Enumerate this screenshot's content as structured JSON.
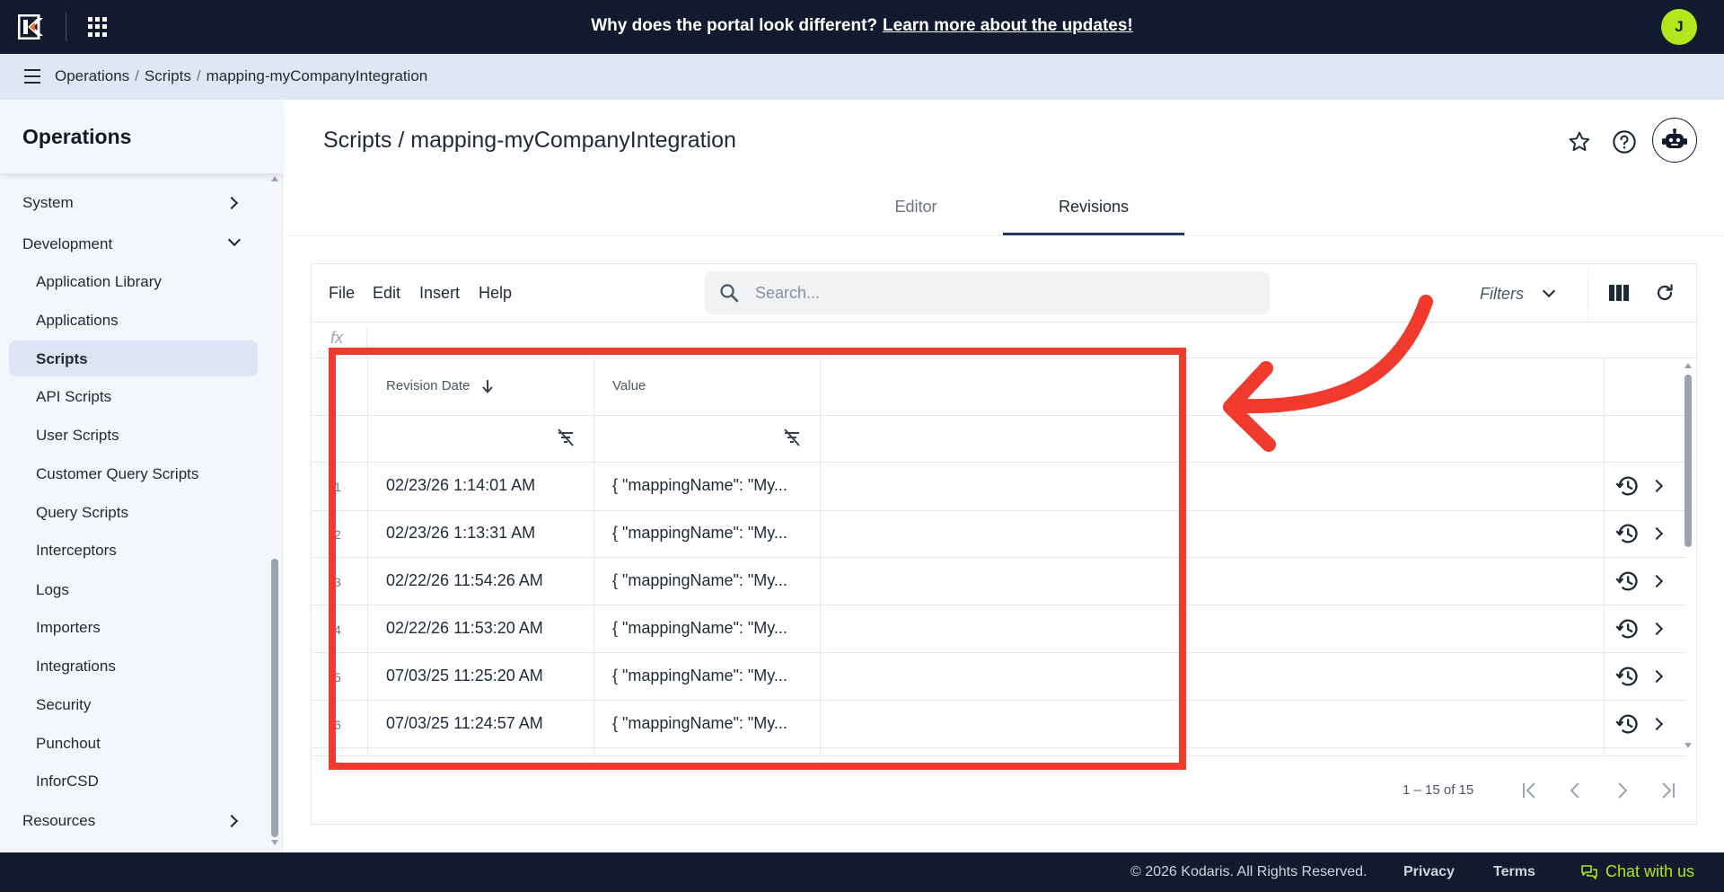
{
  "topbar": {
    "announcement": "Why does the portal look different?",
    "announcement_link": "Learn more about the updates!",
    "avatar_initial": "J",
    "accent": "#b5e61d",
    "background": "#111a2e"
  },
  "breadcrumb": {
    "items": [
      "Operations",
      "Scripts",
      "mapping-myCompanyIntegration"
    ],
    "separator": "/"
  },
  "sidebar": {
    "title": "Operations",
    "items": [
      {
        "label": "System",
        "type": "group",
        "expanded": false
      },
      {
        "label": "Development",
        "type": "group",
        "expanded": true
      },
      {
        "label": "Application Library"
      },
      {
        "label": "Applications"
      },
      {
        "label": "Scripts",
        "active": true
      },
      {
        "label": "API Scripts"
      },
      {
        "label": "User Scripts"
      },
      {
        "label": "Customer Query Scripts"
      },
      {
        "label": "Query Scripts"
      },
      {
        "label": "Interceptors"
      },
      {
        "label": "Logs"
      },
      {
        "label": "Importers"
      },
      {
        "label": "Integrations"
      },
      {
        "label": "Security"
      },
      {
        "label": "Punchout"
      },
      {
        "label": "InforCSD"
      },
      {
        "label": "Resources",
        "type": "group",
        "expanded": false
      }
    ]
  },
  "page": {
    "title": "Scripts / mapping-myCompanyIntegration",
    "tabs": [
      {
        "label": "Editor",
        "active": false
      },
      {
        "label": "Revisions",
        "active": true
      }
    ]
  },
  "grid": {
    "menu": [
      "File",
      "Edit",
      "Insert",
      "Help"
    ],
    "search_placeholder": "Search...",
    "filters_label": "Filters",
    "fx_label": "fx",
    "columns": [
      {
        "label": "Revision Date",
        "sort": "desc"
      },
      {
        "label": "Value"
      }
    ],
    "rows": [
      {
        "num": "1",
        "date": "02/23/26 1:14:01 AM",
        "value": "{ \"mappingName\": \"My..."
      },
      {
        "num": "2",
        "date": "02/23/26 1:13:31 AM",
        "value": "{ \"mappingName\": \"My..."
      },
      {
        "num": "3",
        "date": "02/22/26 11:54:26 AM",
        "value": "{ \"mappingName\": \"My..."
      },
      {
        "num": "4",
        "date": "02/22/26 11:53:20 AM",
        "value": "{ \"mappingName\": \"My..."
      },
      {
        "num": "5",
        "date": "07/03/25 11:25:20 AM",
        "value": "{ \"mappingName\": \"My..."
      },
      {
        "num": "6",
        "date": "07/03/25 11:24:57 AM",
        "value": "{ \"mappingName\": \"My..."
      }
    ],
    "pagination": "1 – 15 of 15"
  },
  "annotation": {
    "color": "#f03a2e"
  },
  "footer": {
    "copyright": "© 2026 Kodaris. All Rights Reserved.",
    "privacy": "Privacy",
    "terms": "Terms",
    "chat": "Chat with us"
  }
}
